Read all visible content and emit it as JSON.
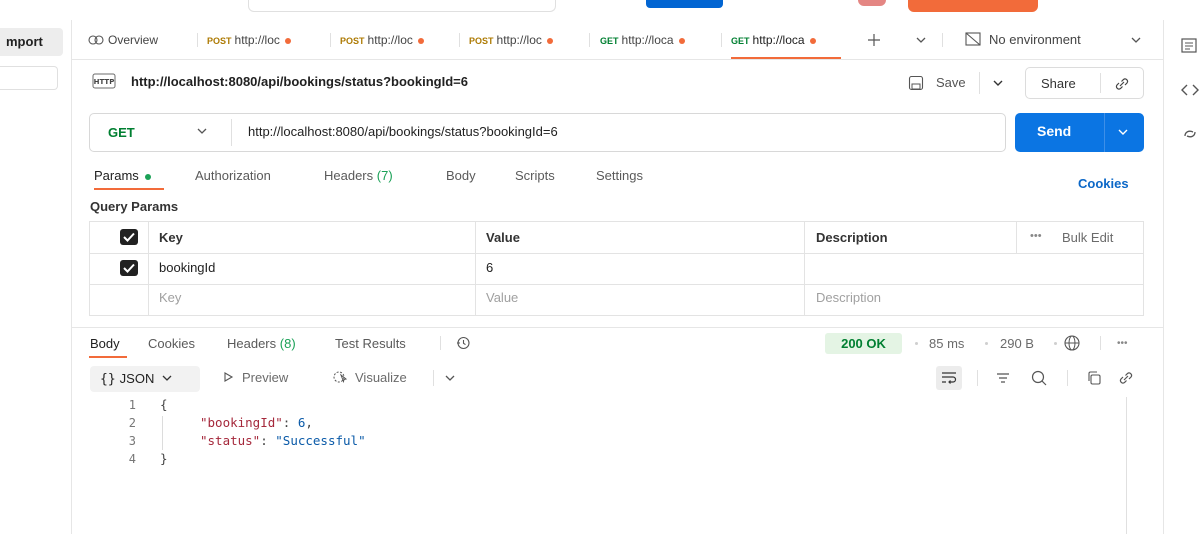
{
  "sidebar": {
    "import_label": "mport"
  },
  "tabs": {
    "overview": "Overview",
    "items": [
      {
        "method": "POST",
        "label": "http://loc"
      },
      {
        "method": "POST",
        "label": "http://loc"
      },
      {
        "method": "POST",
        "label": "http://loc"
      },
      {
        "method": "GET",
        "label": "http://loca"
      },
      {
        "method": "GET",
        "label": "http://loca"
      }
    ],
    "environment": "No environment"
  },
  "request": {
    "title_url": "http://localhost:8080/api/bookings/status?bookingId=6",
    "save_label": "Save",
    "share_label": "Share",
    "method": "GET",
    "url": "http://localhost:8080/api/bookings/status?bookingId=6",
    "send_label": "Send"
  },
  "request_tabs": {
    "params": "Params",
    "authorization": "Authorization",
    "headers": "Headers",
    "headers_count": "(7)",
    "body": "Body",
    "scripts": "Scripts",
    "settings": "Settings",
    "cookies": "Cookies"
  },
  "query_params": {
    "label": "Query Params",
    "columns": {
      "key": "Key",
      "value": "Value",
      "description": "Description",
      "bulk_edit": "Bulk Edit"
    },
    "rows": [
      {
        "key": "bookingId",
        "value": "6",
        "description": ""
      }
    ],
    "placeholders": {
      "key": "Key",
      "value": "Value",
      "description": "Description"
    }
  },
  "response": {
    "tabs": {
      "body": "Body",
      "cookies": "Cookies",
      "headers": "Headers",
      "headers_count": "(8)",
      "test_results": "Test Results"
    },
    "status": "200 OK",
    "time": "85 ms",
    "size": "290 B",
    "format": "JSON",
    "preview": "Preview",
    "visualize": "Visualize",
    "lines": [
      {
        "n": "1",
        "text": "{"
      },
      {
        "n": "2",
        "key": "\"bookingId\"",
        "value": "6",
        "trail": ","
      },
      {
        "n": "3",
        "key": "\"status\"",
        "value": "\"Successful\"",
        "trail": ""
      },
      {
        "n": "4",
        "text": "}"
      }
    ]
  },
  "colors": {
    "accent": "#f26b3a",
    "send": "#0b75e3",
    "get": "#007f31",
    "post": "#ad7a03"
  }
}
